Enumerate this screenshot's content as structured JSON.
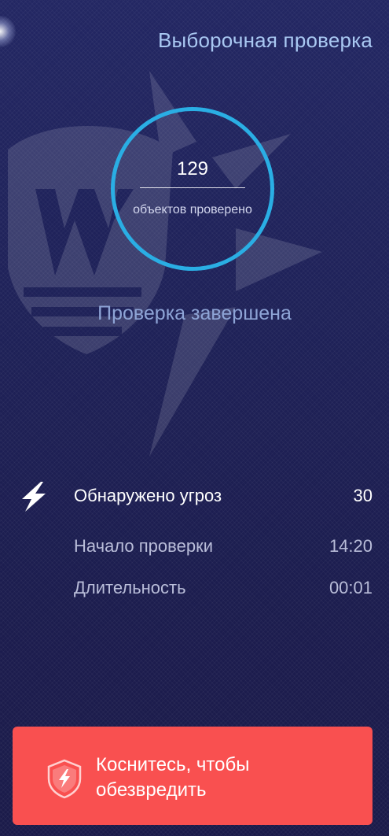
{
  "header": {
    "title": "Выборочная проверка"
  },
  "progress": {
    "count": "129",
    "label": "объектов проверено"
  },
  "status": {
    "text": "Проверка завершена"
  },
  "stats": {
    "threats_label": "Обнаружено угроз",
    "threats_value": "30",
    "start_label": "Начало проверки",
    "start_value": "14:20",
    "duration_label": "Длительность",
    "duration_value": "00:01"
  },
  "action": {
    "label": "Коснитесь, чтобы обезвредить",
    "color": "#f95050"
  },
  "icons": {
    "threats": "lightning-bolt-icon",
    "action": "shield-lightning-icon",
    "watermark": "drweb-spider-logo"
  },
  "colors": {
    "background": "#1f2259",
    "accent_ring": "#2aaee4",
    "title": "#a9c8f2",
    "status": "#8ea4d6"
  }
}
